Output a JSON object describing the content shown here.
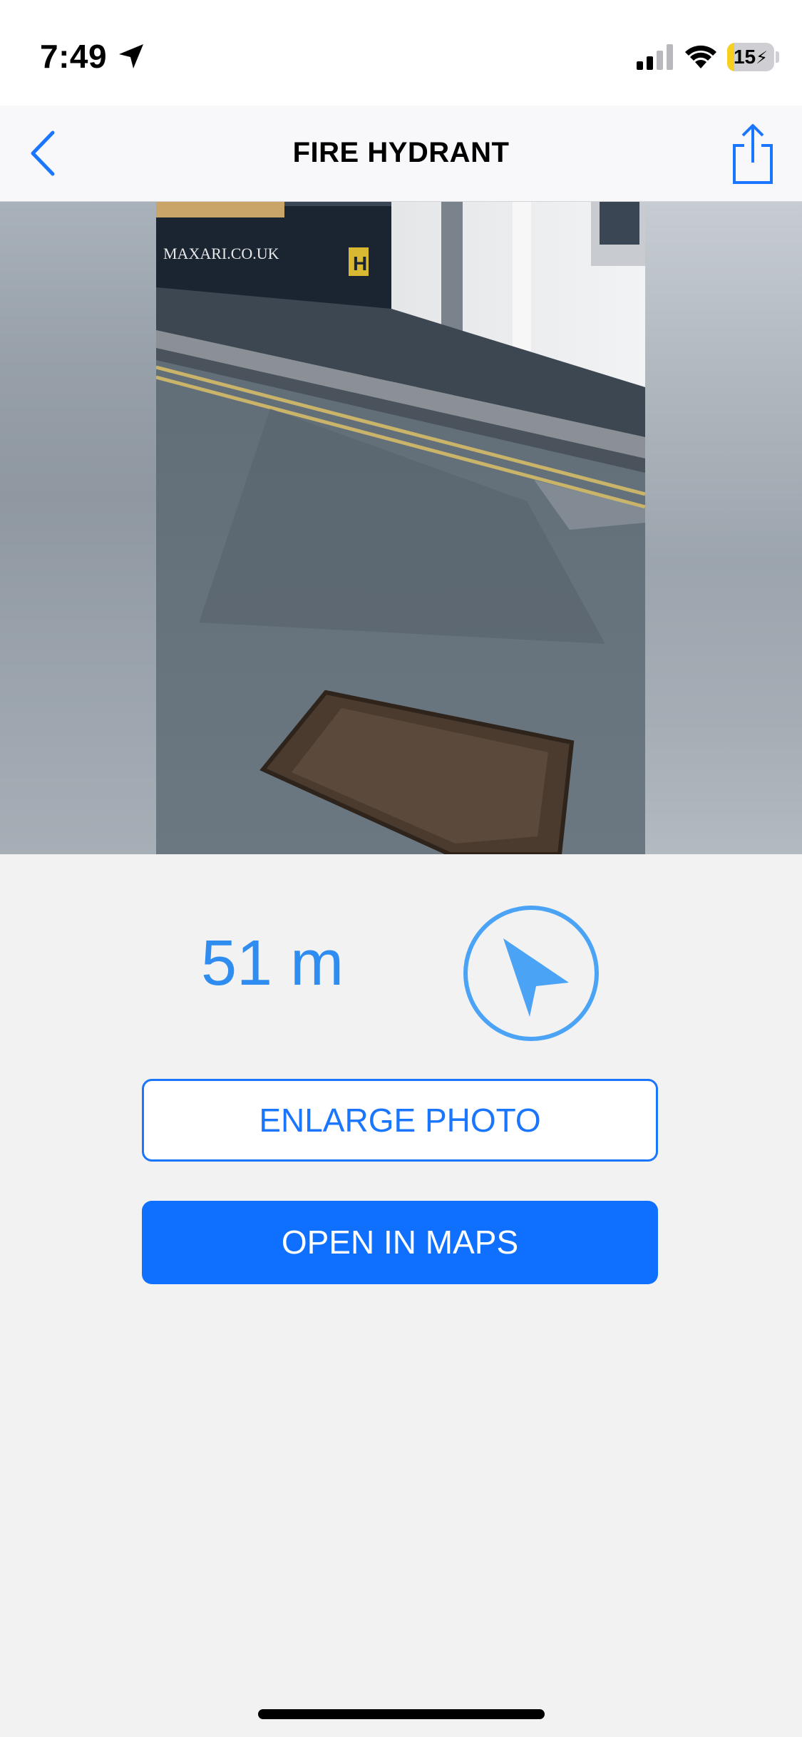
{
  "status_bar": {
    "time": "7:49",
    "battery_level": "15",
    "battery_fraction": 0.15,
    "icons": [
      "location-arrow-icon",
      "cellular-signal-icon",
      "wifi-icon",
      "battery-charging-icon"
    ]
  },
  "nav": {
    "title": "FIRE HYDRANT",
    "back_icon": "chevron-left-icon",
    "share_icon": "share-icon"
  },
  "photo": {
    "sign_text": "MAXARI.CO.UK",
    "hydrant_marker": "H"
  },
  "location": {
    "distance": "51 m",
    "direction_icon": "navigation-arrow-icon"
  },
  "buttons": {
    "enlarge": "ENLARGE PHOTO",
    "open_maps": "OPEN IN MAPS"
  },
  "colors": {
    "accent": "#1a75ff",
    "primary_button": "#0f6ffe",
    "distance": "#2f8cf0",
    "battery_fill": "#f7cf1e"
  }
}
